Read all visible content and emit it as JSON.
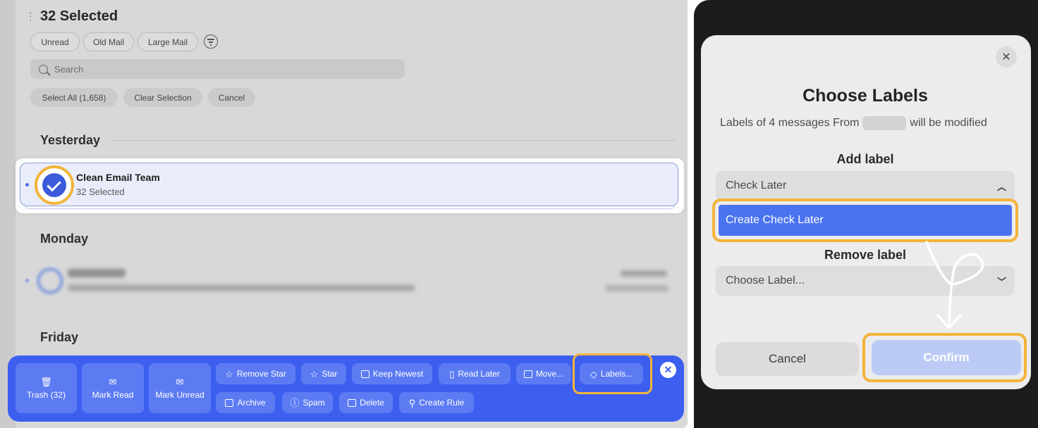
{
  "left_panel": {
    "title": "32 Selected",
    "filters": [
      "Unread",
      "Old Mail",
      "Large Mail"
    ],
    "search_placeholder": "Search",
    "selection_buttons": [
      "Select All (1,658)",
      "Clear Selection",
      "Cancel"
    ],
    "sections": [
      "Yesterday",
      "Monday",
      "Friday"
    ],
    "selected_message": {
      "sender": "Clean Email Team",
      "subtitle": "32 Selected"
    }
  },
  "action_bar": {
    "large_buttons": [
      "Trash (32)",
      "Mark Read",
      "Mark Unread"
    ],
    "row1": [
      "Remove Star",
      "Star",
      "Keep Newest",
      "Read Later",
      "Move...",
      "Labels..."
    ],
    "row2": [
      "Archive",
      "Spam",
      "Delete",
      "Create Rule"
    ]
  },
  "modal": {
    "title": "Choose Labels",
    "description_prefix": "Labels of 4 messages From",
    "description_suffix": "will be modified",
    "add_label_heading": "Add label",
    "add_label_value": "Check Later",
    "add_label_option": "Create Check Later",
    "remove_label_heading": "Remove label",
    "remove_label_placeholder": "Choose Label...",
    "cancel_label": "Cancel",
    "confirm_label": "Confirm"
  },
  "icons": {
    "close": "close-icon",
    "filter": "filter-icon",
    "chevron_up": "chevron-up-icon",
    "chevron_down": "chevron-down-icon"
  },
  "colors": {
    "accent": "#3d5ff0",
    "highlight": "#f4b43a",
    "option_blue": "#4a73f0",
    "confirm_disabled": "#bccbf6"
  }
}
